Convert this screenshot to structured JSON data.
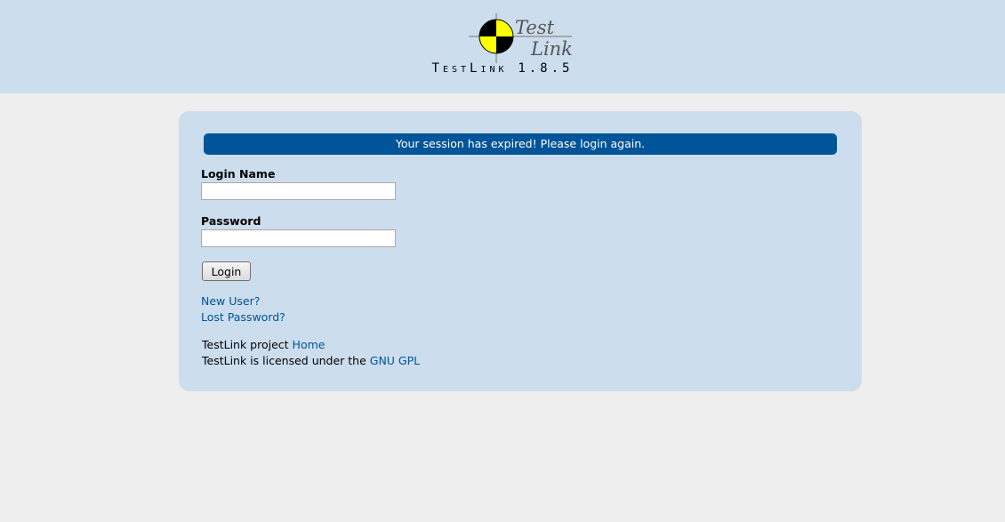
{
  "header": {
    "logo_text_line1": "Test",
    "logo_text_line2": "Link",
    "version_title": "TestLink 1.8.5",
    "version_parts": {
      "t1": "T",
      "est": "EST",
      "l": "L",
      "ink": "INK",
      "num": "1.8.5"
    }
  },
  "login": {
    "message": "Your session has expired! Please login again.",
    "login_name_label": "Login Name",
    "login_name_value": "",
    "password_label": "Password",
    "password_value": "",
    "login_button": "Login",
    "new_user_link": "New User?",
    "lost_password_link": "Lost Password?"
  },
  "footer": {
    "project_text": "TestLink project ",
    "home_link": "Home",
    "license_text": "TestLink is licensed under the ",
    "gpl_link": "GNU GPL"
  },
  "colors": {
    "header_bg": "#ccdded",
    "page_bg": "#eeeeee",
    "message_bg": "#005498",
    "link": "#005498"
  },
  "icons": {
    "logo": "testlink-crosshair-logo-icon"
  }
}
